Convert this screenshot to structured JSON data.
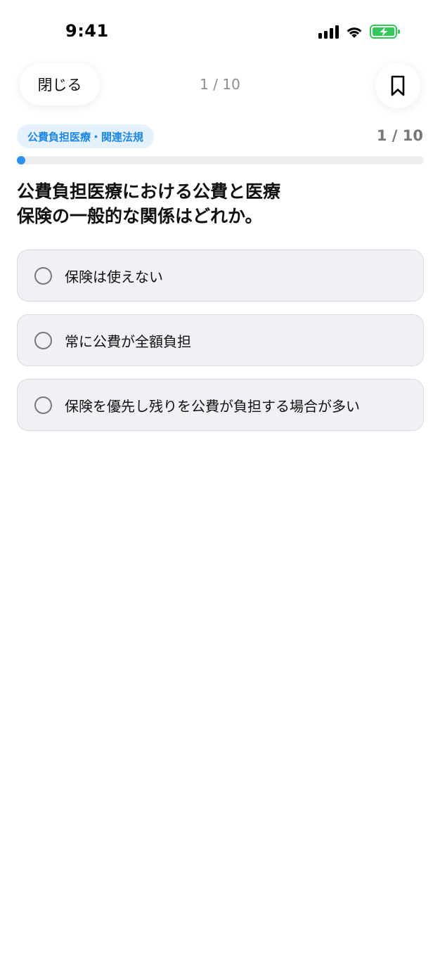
{
  "status_bar": {
    "time": "9:41",
    "icons": [
      "cellular-signal-icon",
      "wifi-icon",
      "battery-charging-icon"
    ],
    "battery_color": "#34c759"
  },
  "nav": {
    "close_label": "閉じる",
    "counter": "1 / 10",
    "bookmark_icon": "bookmark-icon"
  },
  "quiz": {
    "category": "公費負担医療・関連法規",
    "counter": "1 / 10",
    "progress": {
      "current": 1,
      "total": 10
    },
    "question": "公費負担医療における公費と医療\n保険の一般的な関係はどれか。",
    "options": [
      {
        "label": "保険は使えない",
        "selected": false
      },
      {
        "label": "常に公費が全額負担",
        "selected": false
      },
      {
        "label": "保険を優先し残りを公費が負担する場合が多い",
        "selected": false
      }
    ]
  },
  "colors": {
    "accent": "#2e8ff2",
    "chip_background": "#e5f1fd",
    "chip_text": "#1e88e5",
    "option_background": "#f1f1f5"
  }
}
